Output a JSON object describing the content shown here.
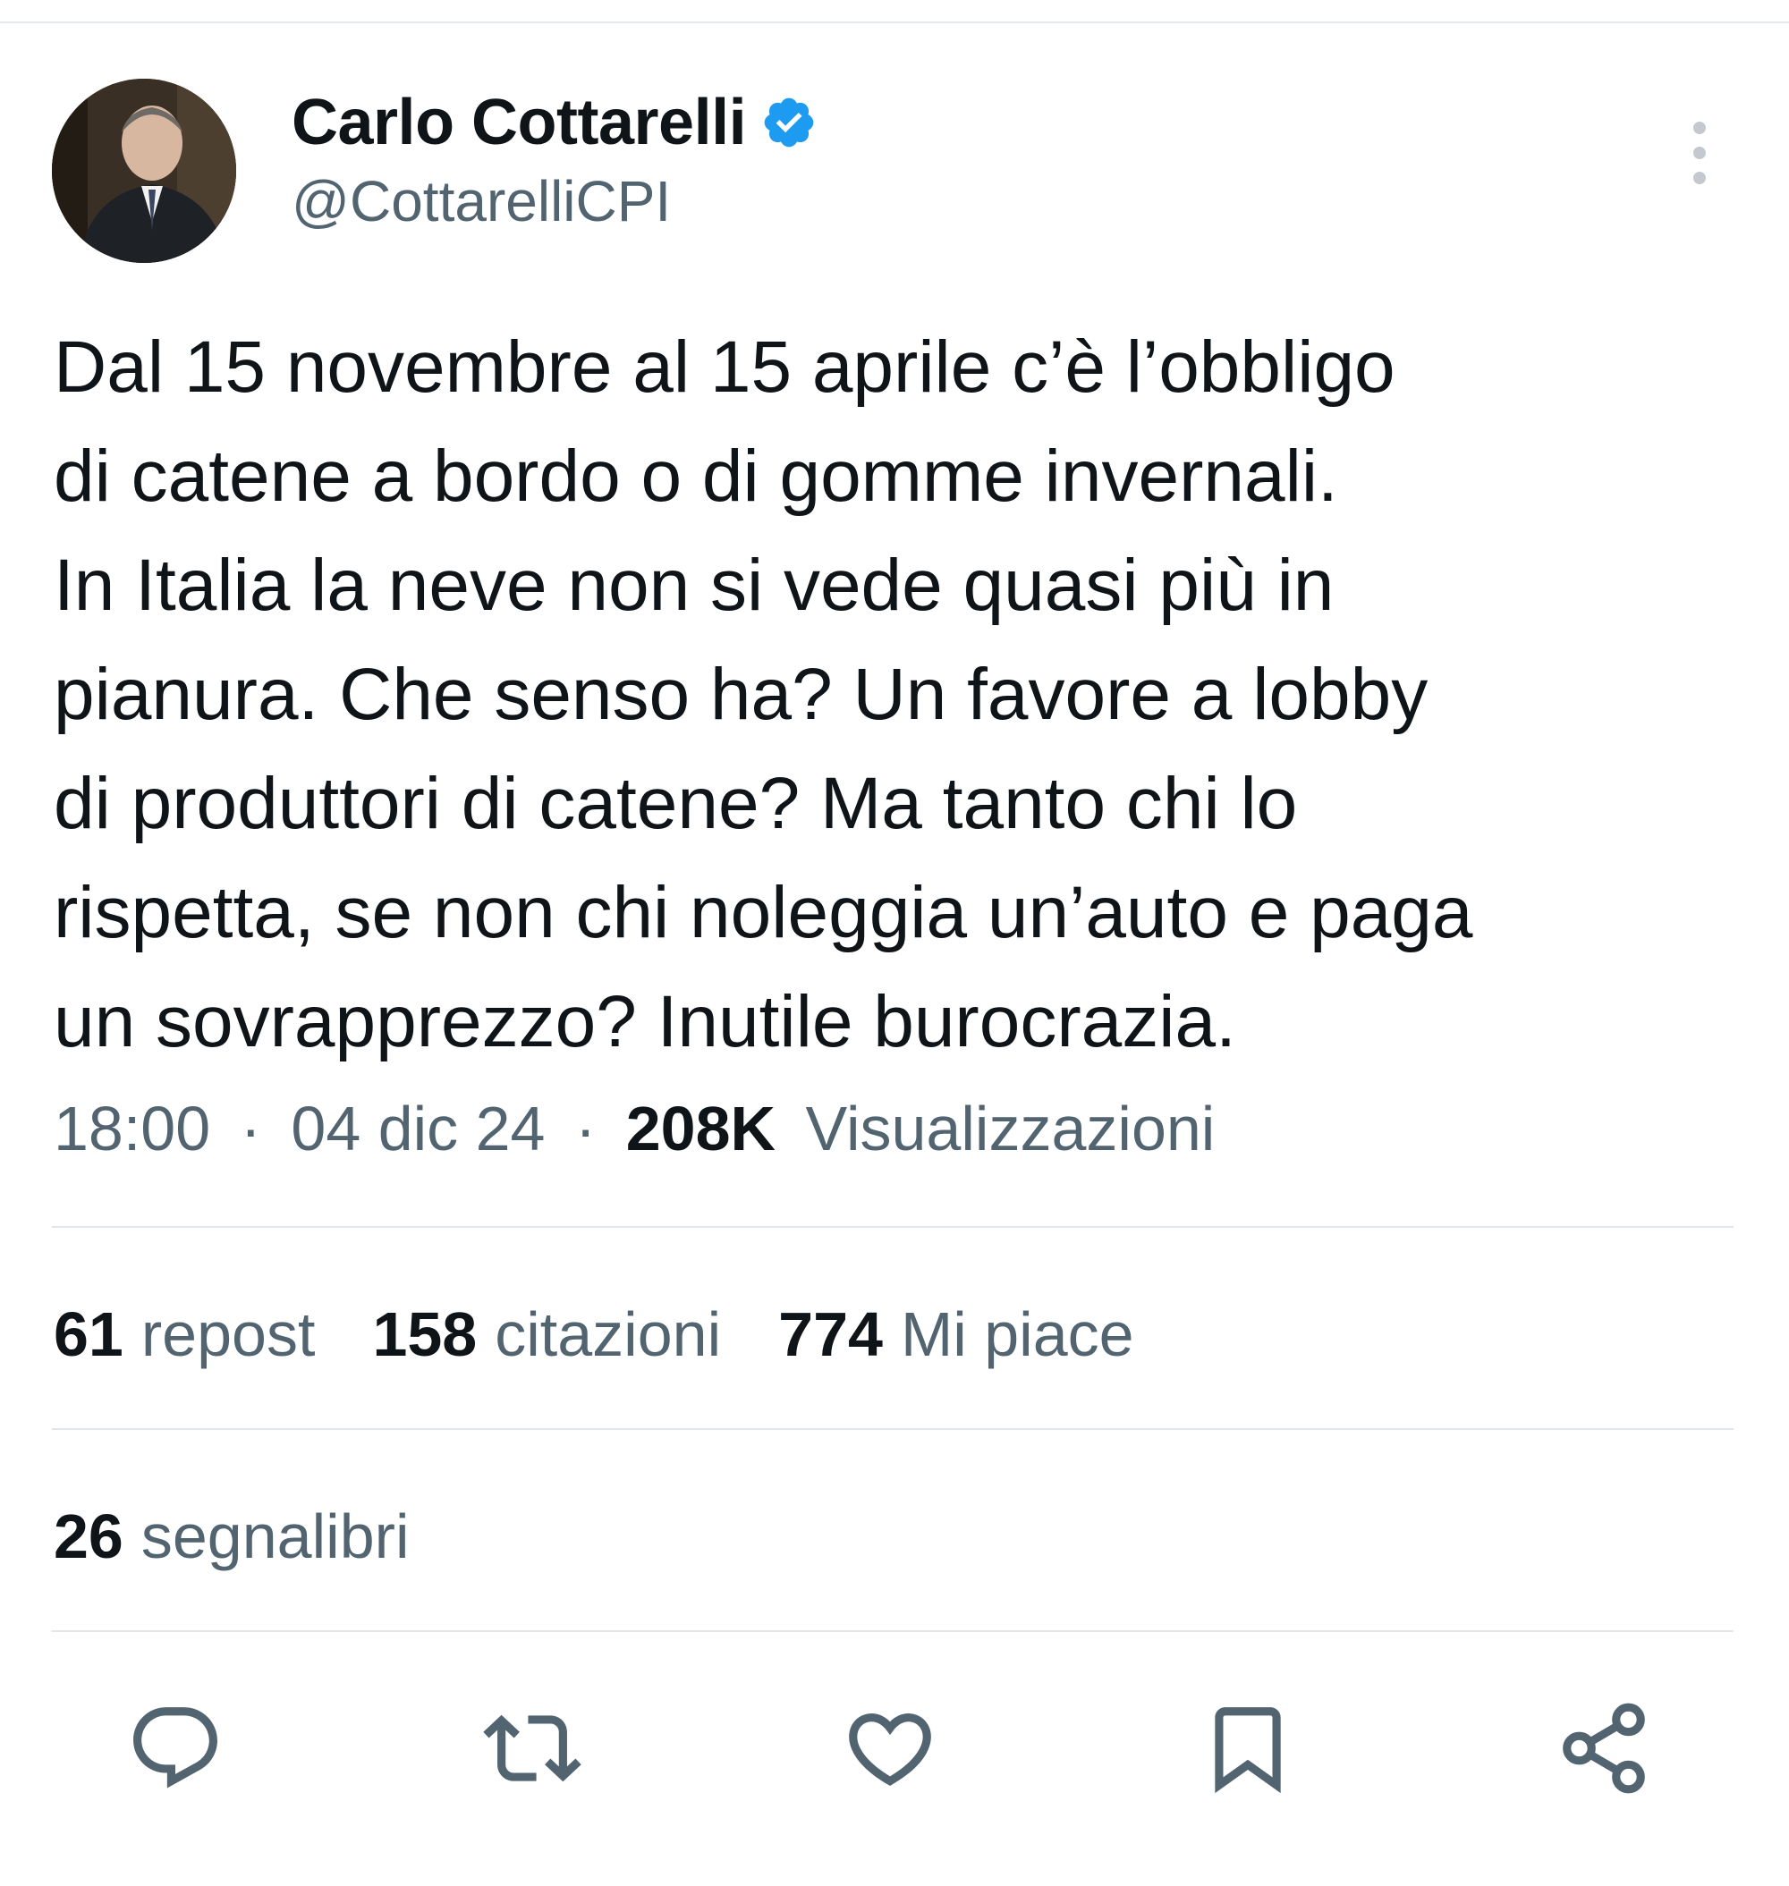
{
  "author": {
    "name": "Carlo Cottarelli",
    "handle": "@CottarelliCPI",
    "verified": true
  },
  "tweet": {
    "lines": [
      "Dal 15 novembre al 15 aprile c’è l’obbligo",
      "di catene a bordo o di gomme invernali.",
      "In Italia la neve non si vede quasi più in",
      "pianura. Che senso ha? Un favore a lobby",
      "di produttori di catene? Ma tanto chi lo",
      "rispetta, se non chi noleggia un’auto e paga",
      "un sovrapprezzo? Inutile burocrazia."
    ]
  },
  "meta": {
    "time": "18:00",
    "separator": "·",
    "date": "04 dic 24",
    "views_count": "208K",
    "views_label": "Visualizzazioni"
  },
  "stats": {
    "reposts_count": "61",
    "reposts_label": "repost",
    "quotes_count": "158",
    "quotes_label": "citazioni",
    "likes_count": "774",
    "likes_label": "Mi piace",
    "bookmarks_count": "26",
    "bookmarks_label": "segnalibri"
  },
  "icons": {
    "more": "more-vertical-icon",
    "verified": "verified-badge-icon",
    "reply": "reply-icon",
    "repost": "repost-icon",
    "like": "heart-icon",
    "bookmark": "bookmark-icon",
    "share": "share-icon"
  },
  "colors": {
    "text_primary": "#0f1419",
    "text_secondary": "#536471",
    "verified_blue": "#1d9bf0",
    "icon_gray": "#536471",
    "divider": "#e3e6e9"
  }
}
